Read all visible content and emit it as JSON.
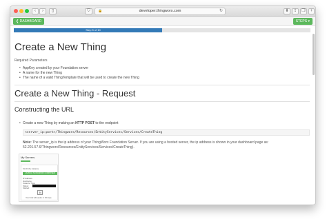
{
  "browser": {
    "url": "developer.thingworx.com",
    "lock_icon": "lock-icon",
    "reload_icon": "reload-icon"
  },
  "nav": {
    "dashboard_label": "❮ DASHBOARD",
    "steps_label": "STEPS ▾"
  },
  "progress": {
    "label": "Step 5 of 10",
    "fraction": 0.5,
    "color": "#337ab7"
  },
  "section1": {
    "title": "Create a New Thing",
    "subtitle": "Required Parameters",
    "bullets": [
      "AppKey created by your Foundation server",
      "A name for the new Thing",
      "The name of a valid ThingTemplate that will be used to create the new Thing"
    ]
  },
  "section2": {
    "title": "Create a New Thing - Request",
    "subheading": "Constructing the URL",
    "bullet_prefix": "Create a new Thing by making an ",
    "bullet_bold": "HTTP POST",
    "bullet_suffix": " to the endpoint",
    "code": "<server_ip:port>/Thingworx/Resources/EntityServices/Services/CreateThing",
    "note_label": "Note:",
    "note_line1": " The server_ip is the ip address of your ThingWorx Foundation Server. If you are using a hosted server, the ip address is shown in your dashboard page as:",
    "note_line2": "52.201.57.6/Thingworx/Resources/EntityServices/Services/CreateThing)."
  },
  "screenshot": {
    "title": "My Servers",
    "card_line1": "Fix ID the instance",
    "green_label": "LAUNCH THINGWORX COMPOSER",
    "lines": [
      "IP Address:",
      "Hostname:",
      "Instance Type:",
      "Status:",
      "Started:"
    ],
    "count": "34",
    "footer": "Your trial will expire in 34 days"
  }
}
